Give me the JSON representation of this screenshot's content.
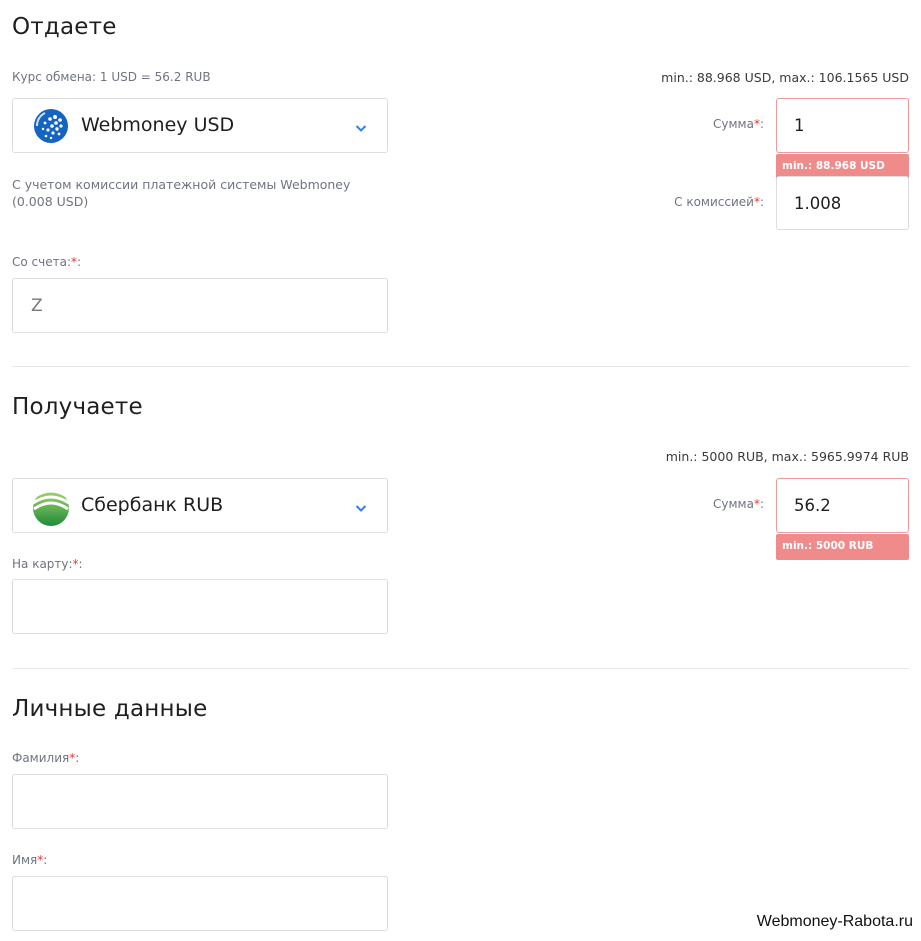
{
  "give": {
    "title": "Отдаете",
    "rate": "Курс обмена: 1 USD = 56.2 RUB",
    "limits": "min.: 88.968 USD, max.: 106.1565 USD",
    "currency": {
      "label": "Webmoney USD",
      "icon": "webmoney-globe-icon"
    },
    "commission_note_1": "С учетом комиссии платежной системы Webmoney",
    "commission_note_2": "(0.008 USD)",
    "amount_label": "Сумма",
    "amount_value": "1",
    "amount_error": "min.: 88.968 USD",
    "with_commission_label": "С комиссией",
    "with_commission_value": "1.008",
    "account_label": "Со счета:",
    "account_value": "Z"
  },
  "receive": {
    "title": "Получаете",
    "limits": "min.: 5000 RUB, max.: 5965.9974 RUB",
    "currency": {
      "label": "Сбербанк RUB",
      "icon": "sberbank-logo-icon"
    },
    "amount_label": "Сумма",
    "amount_value": "56.2",
    "amount_error": "min.: 5000 RUB",
    "card_label": "На карту:",
    "card_value": ""
  },
  "personal": {
    "title": "Личные данные",
    "surname_label": "Фамилия",
    "surname_value": "",
    "name_label": "Имя",
    "name_value": ""
  },
  "required_mark": "*",
  "label_colon": ":",
  "watermark": "Webmoney-Rabota.ru",
  "colors": {
    "error_badge": "#ef8b8b",
    "error_border": "#ef9a9a",
    "required": "#e53935",
    "chevron": "#2f80ed",
    "sberbank_green": "#2e9b3e",
    "webmoney_blue": "#1565c0"
  }
}
